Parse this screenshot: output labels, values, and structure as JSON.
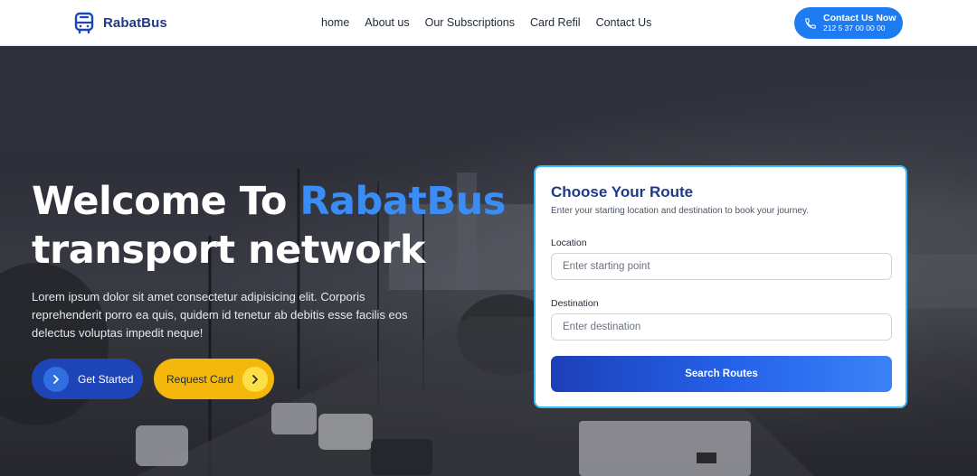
{
  "brand": {
    "name": "RabatBus",
    "color": "#1e3a8a"
  },
  "nav": {
    "items": [
      {
        "label": "home"
      },
      {
        "label": "About us"
      },
      {
        "label": "Our Subscriptions"
      },
      {
        "label": "Card Refil"
      },
      {
        "label": "Contact Us"
      }
    ]
  },
  "contact": {
    "label": "Contact Us Now",
    "phone": "212 5 37 00 00 00"
  },
  "hero": {
    "title_part1": "Welcome To ",
    "title_accent": "RabatBus",
    "title_part2": "transport network",
    "description": "Lorem ipsum dolor sit amet consectetur adipisicing elit. Corporis reprehenderit porro ea quis, quidem id tenetur ab debitis esse facilis eos delectus voluptas impedit neque!",
    "accent_color": "#3b8cf5",
    "btn_start": "Get Started",
    "btn_card": "Request Card"
  },
  "route_card": {
    "title": "Choose Your Route",
    "subtitle": "Enter your starting location and destination to book your journey.",
    "location_label": "Location",
    "location_placeholder": "Enter starting point",
    "destination_label": "Destination",
    "destination_placeholder": "Enter destination",
    "search_label": "Search Routes"
  },
  "colors": {
    "primary": "#1d7cf2",
    "dark_blue": "#1e45b8",
    "yellow": "#f4b70c",
    "card_border": "#38bdf8"
  }
}
